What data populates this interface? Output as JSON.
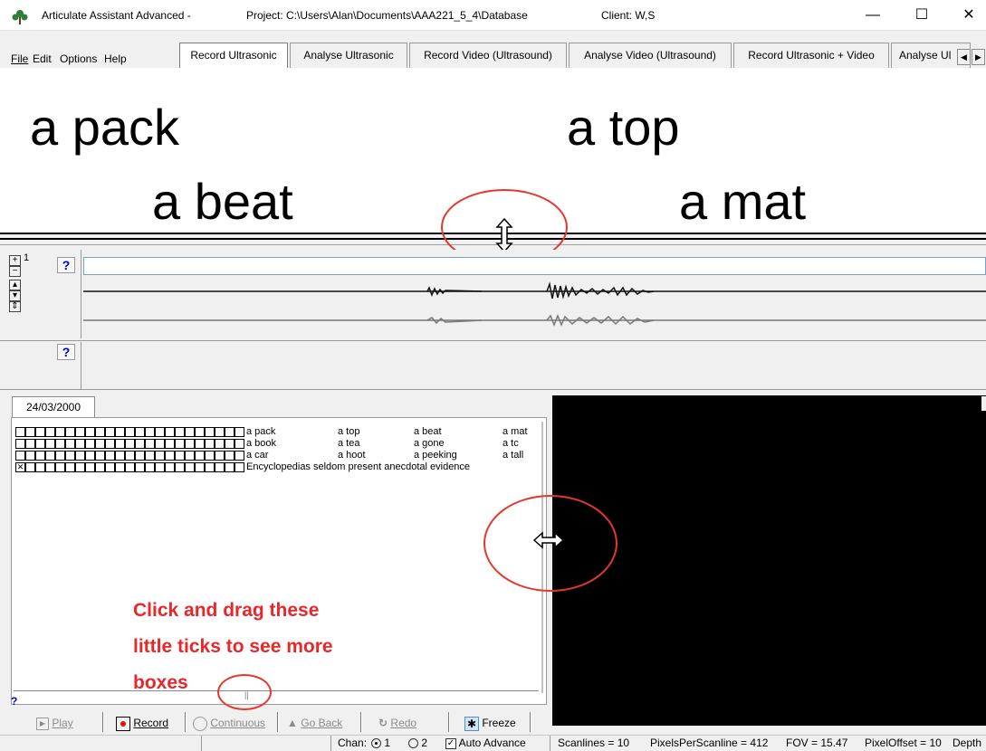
{
  "window": {
    "app_title": "Articulate Assistant Advanced -",
    "project": "Project: C:\\Users\\Alan\\Documents\\AAA221_5_4\\Database",
    "client": "Client: W,S",
    "minimize": "—",
    "maximize": "☐",
    "close": "✕"
  },
  "menu": {
    "file": "File",
    "edit": "Edit",
    "options": "Options",
    "help": "Help"
  },
  "tabs": [
    {
      "label": "Record Ultrasonic",
      "active": true
    },
    {
      "label": "Analyse Ultrasonic",
      "active": false
    },
    {
      "label": "Record Video (Ultrasound)",
      "active": false
    },
    {
      "label": "Analyse Video (Ultrasound)",
      "active": false
    },
    {
      "label": "Record Ultrasonic + Video",
      "active": false
    },
    {
      "label": "Analyse Ul",
      "active": false
    }
  ],
  "prompt": {
    "word1": "a pack",
    "word2": "a top",
    "word3": "a beat",
    "word4": "a mat"
  },
  "channels": {
    "channel_number": "1",
    "help_label": "?"
  },
  "session": {
    "date_tab": "24/03/2000",
    "rows": [
      {
        "checked": false,
        "words": [
          "a pack",
          "a top",
          "a beat",
          "a mat"
        ]
      },
      {
        "checked": false,
        "words": [
          "a book",
          "a tea",
          "a gone",
          "a tc"
        ]
      },
      {
        "checked": false,
        "words": [
          "a car",
          "a hoot",
          "a peeking",
          "a tall"
        ]
      },
      {
        "checked": true,
        "words": [
          "Encyclopedias seldom present anecdotal evidence"
        ]
      }
    ]
  },
  "annotation": {
    "line1": "Click and drag these",
    "line2": "little ticks to see more",
    "line3": "boxes"
  },
  "toolbar": {
    "play": "Play",
    "record": "Record",
    "continuous": "Continuous",
    "go_back": "Go Back",
    "redo": "Redo",
    "freeze": "Freeze"
  },
  "status": {
    "chan_label": "Chan:",
    "chan1": "1",
    "chan2": "2",
    "selected_channel": 1,
    "auto_advance": "Auto Advance",
    "auto_advance_checked": true,
    "scanlines": "Scanlines = 10",
    "pixels_per_scanline": "PixelsPerScanline = 412",
    "fov": "FOV = 15.47",
    "pixel_offset": "PixelOffset = 10",
    "depth": "Depth"
  },
  "colors": {
    "annotation_red": "#e8272b",
    "help_blue": "#0000cc",
    "video_bg": "#000000"
  }
}
